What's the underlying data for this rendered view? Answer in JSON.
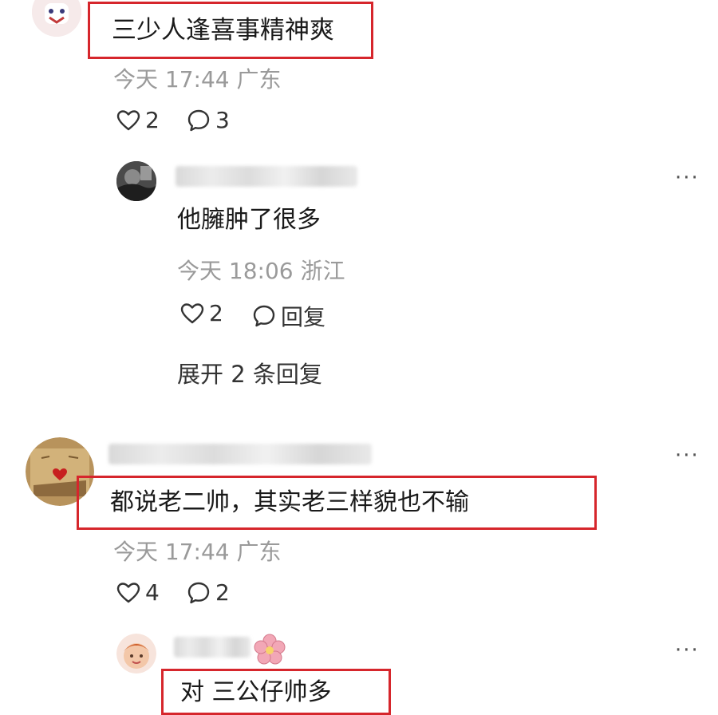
{
  "comments": [
    {
      "text": "三少人逢喜事精神爽",
      "time": "今天 17:44",
      "location": "广东",
      "likes": "2",
      "replies": "3"
    },
    {
      "text": "他臃肿了很多",
      "time": "今天 18:06",
      "location": "浙江",
      "likes": "2",
      "reply_label": "回复",
      "expand_label": "展开 2 条回复"
    },
    {
      "text": "都说老二帅，其实老三样貌也不输",
      "time": "今天 17:44",
      "location": "广东",
      "likes": "4",
      "replies": "2"
    },
    {
      "text": "对 三公仔帅多"
    }
  ],
  "more_label": "···",
  "colors": {
    "highlight": "#d6262c",
    "meta": "#9a9a9a"
  }
}
